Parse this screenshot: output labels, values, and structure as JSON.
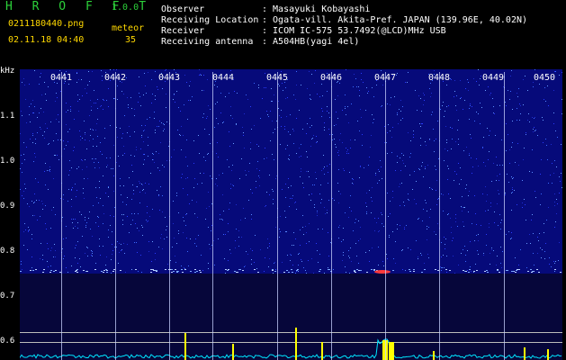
{
  "header": {
    "app_name": "H R O F F T",
    "version": "1.0.0",
    "filename": "0211180440.png",
    "datetime": "02.11.18 04:40",
    "meteor_label": "meteor",
    "meteor_count": "35"
  },
  "info": [
    {
      "key": "Observer",
      "value": ": Masayuki Kobayashi"
    },
    {
      "key": "Receiving Location",
      "value": ": Ogata-vill. Akita-Pref. JAPAN (139.96E, 40.02N)"
    },
    {
      "key": "Receiver",
      "value": ": ICOM IC-575 53.7492(@LCD)MHz USB"
    },
    {
      "key": "Receiving antenna",
      "value": ": A504HB(yagi 4el)"
    }
  ],
  "axis": {
    "unit": "kHz",
    "ticks": [
      "1.1",
      "1.0",
      "0.9",
      "0.8",
      "0.7",
      "0.6"
    ]
  },
  "time_labels": [
    "0441",
    "0442",
    "0443",
    "0444",
    "0445",
    "0446",
    "0447",
    "0448",
    "0449",
    "0450"
  ],
  "colors": {
    "background": "#060a7a",
    "header_green": "#2cd13a",
    "header_yellow": "#ffd800",
    "trace": "#ffff00",
    "noise": "#00e5ff"
  }
}
